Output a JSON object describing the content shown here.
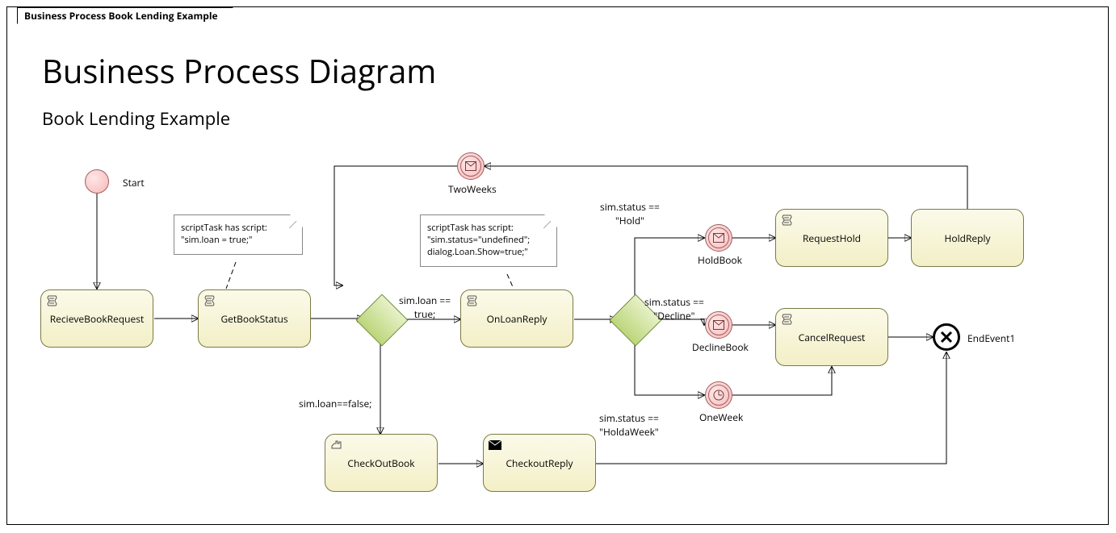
{
  "frame_title": "Business Process Book Lending Example",
  "heading": "Business Process Diagram",
  "subheading": "Book Lending Example",
  "events": {
    "start": {
      "label": "Start"
    },
    "twoWeeks": {
      "label": "TwoWeeks"
    },
    "holdBook": {
      "label": "HoldBook"
    },
    "declineBook": {
      "label": "DeclineBook"
    },
    "oneWeek": {
      "label": "OneWeek"
    },
    "end": {
      "label": "EndEvent1"
    }
  },
  "tasks": {
    "recieveBookRequest": {
      "label": "RecieveBookRequest",
      "kind": "script"
    },
    "getBookStatus": {
      "label": "GetBookStatus",
      "kind": "script"
    },
    "onLoanReply": {
      "label": "OnLoanReply",
      "kind": "script"
    },
    "checkOutBook": {
      "label": "CheckOutBook",
      "kind": "manual"
    },
    "checkoutReply": {
      "label": "CheckoutReply",
      "kind": "receive"
    },
    "requestHold": {
      "label": "RequestHold",
      "kind": "script"
    },
    "holdReply": {
      "label": "HoldReply"
    },
    "cancelRequest": {
      "label": "CancelRequest",
      "kind": "script"
    }
  },
  "notes": {
    "note1": {
      "line1": "scriptTask has script:",
      "line2": "\"sim.loan = true;\""
    },
    "note2": {
      "line1": "scriptTask has script:",
      "line2": "\"sim.status=\"undefined\"; dialog.Loan.Show=true;\""
    }
  },
  "flow_labels": {
    "loanTrue": "sim.loan ==\ntrue;",
    "loanFalse": "sim.loan==false;",
    "statusHold": "sim.status ==\n\"Hold\"",
    "statusDecline": "sim.status ==\n\"Decline\"",
    "statusHoldWeek": "sim.status ==\n\"HoldaWeek\""
  }
}
